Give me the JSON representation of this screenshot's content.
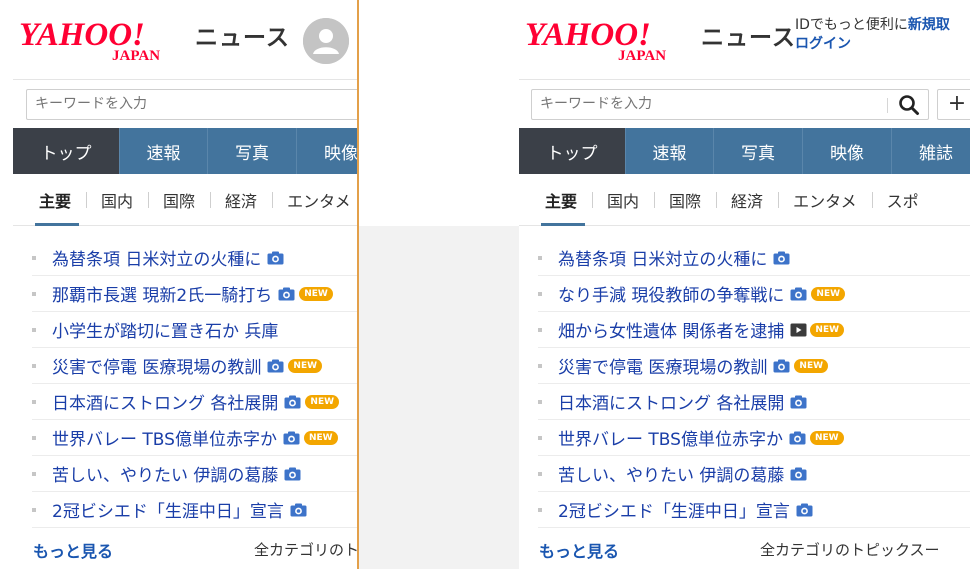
{
  "header": {
    "logo_alt": "YAHOO! JAPAN",
    "service": "ニュース",
    "login_promo_text": "IDでもっと便利に",
    "login_promo_signup": "新規取",
    "login_promo_login": "ログイン"
  },
  "search": {
    "placeholder": "キーワードを入力",
    "add_label": "+"
  },
  "tabs": [
    "トップ",
    "速報",
    "写真",
    "映像",
    "雑誌"
  ],
  "subtabs": [
    "主要",
    "国内",
    "国際",
    "経済",
    "エンタメ",
    "スポ"
  ],
  "left_topics": [
    {
      "title": "為替条項 日米対立の火種に",
      "camera": true,
      "video": false,
      "new": false
    },
    {
      "title": "那覇市長選 現新2氏一騎打ち",
      "camera": true,
      "video": false,
      "new": true
    },
    {
      "title": "小学生が踏切に置き石か 兵庫",
      "camera": false,
      "video": false,
      "new": false
    },
    {
      "title": "災害で停電 医療現場の教訓",
      "camera": true,
      "video": false,
      "new": true
    },
    {
      "title": "日本酒にストロング 各社展開",
      "camera": true,
      "video": false,
      "new": true
    },
    {
      "title": "世界バレー TBS億単位赤字か",
      "camera": true,
      "video": false,
      "new": true
    },
    {
      "title": "苦しい、やりたい 伊調の葛藤",
      "camera": true,
      "video": false,
      "new": false
    },
    {
      "title": "2冠ビシエド「生涯中日」宣言",
      "camera": true,
      "video": false,
      "new": false
    }
  ],
  "right_topics": [
    {
      "title": "為替条項 日米対立の火種に",
      "camera": true,
      "video": false,
      "new": false
    },
    {
      "title": "なり手減 現役教師の争奪戦に",
      "camera": true,
      "video": false,
      "new": true
    },
    {
      "title": "畑から女性遺体 関係者を逮捕",
      "camera": false,
      "video": true,
      "new": true
    },
    {
      "title": "災害で停電 医療現場の教訓",
      "camera": true,
      "video": false,
      "new": true
    },
    {
      "title": "日本酒にストロング 各社展開",
      "camera": true,
      "video": false,
      "new": false
    },
    {
      "title": "世界バレー TBS億単位赤字か",
      "camera": true,
      "video": false,
      "new": true
    },
    {
      "title": "苦しい、やりたい 伊調の葛藤",
      "camera": true,
      "video": false,
      "new": false
    },
    {
      "title": "2冠ビシエド「生涯中日」宣言",
      "camera": true,
      "video": false,
      "new": false
    }
  ],
  "new_badge": "NEW",
  "footer": {
    "more": "もっと見る",
    "all_categories": "全カテゴリのトピックスー"
  },
  "colors": {
    "brand_red": "#ff0033",
    "tab_blue": "#43749d",
    "tab_active": "#3b4048",
    "link_blue": "#1a3ea8",
    "badge_orange": "#f3a600"
  }
}
